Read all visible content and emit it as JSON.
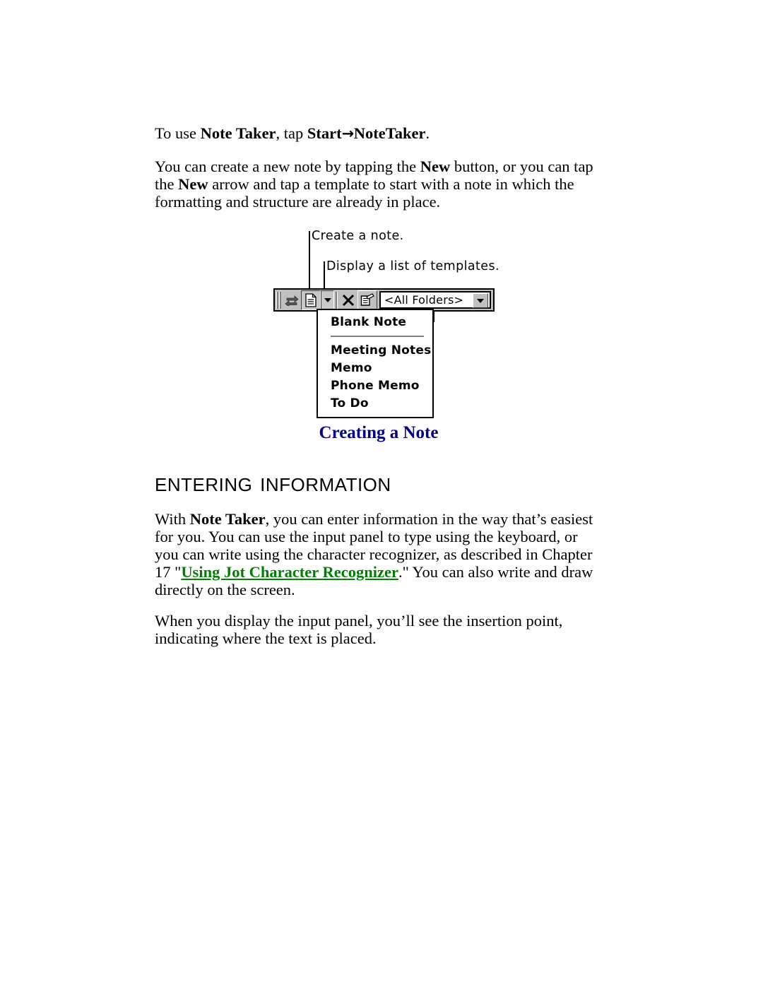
{
  "document": {
    "intro": {
      "prefix": "To use ",
      "app_name": "Note Taker",
      "middle": ", tap ",
      "menu_path_start": "Start",
      "arrow": "→",
      "menu_path_end": "NoteTaker",
      "suffix": "."
    },
    "paragraph_new": {
      "part1": "You can create a new note by tapping the ",
      "bold1": "New",
      "part2": " button, or you can tap the ",
      "bold2": "New",
      "part3": " arrow and tap a template to start with a note in which the formatting and structure are already in place."
    },
    "figure": {
      "callouts": [
        {
          "id": "create-a-note",
          "text": "Create a note."
        },
        {
          "id": "display-templates",
          "text": "Display a list of templates."
        }
      ],
      "toolbar": {
        "icons": [
          {
            "name": "grip-handle",
            "glyph": ""
          },
          {
            "name": "sync-arrows-icon",
            "glyph": "⇄"
          },
          {
            "name": "new-note-icon",
            "glyph": "document"
          },
          {
            "name": "new-dropdown-arrow-icon",
            "glyph": "▼"
          },
          {
            "name": "delete-icon",
            "glyph": "✕"
          },
          {
            "name": "properties-icon",
            "glyph": "properties"
          }
        ],
        "folder_combo": {
          "value": "<All Folders>",
          "placeholder": "<All Folders>"
        }
      },
      "template_menu": {
        "items": [
          "Blank Note",
          "Meeting Notes",
          "Memo",
          "Phone Memo",
          "To Do"
        ]
      },
      "caption": "Creating a Note"
    },
    "section_heading": "Entering Information",
    "paragraph_entering": {
      "part1": "With ",
      "bold1": "Note Taker",
      "part2": ", you can enter information in the way that’s easiest for you. You can use the input panel to type using the keyboard, or you can write using the character recognizer, as described in Chapter 17 \"",
      "link": "Using Jot Character Recognizer",
      "part3": ".\" You can also write and draw directly on the screen."
    },
    "paragraph_input_panel": "When you display the input panel, you’ll see the insertion point, indicating where the text is placed.",
    "colors": {
      "caption_blue": "#00008B",
      "link_green": "#008000",
      "toolbar_gray": "#c0c0c0",
      "text_black": "#000000"
    }
  }
}
